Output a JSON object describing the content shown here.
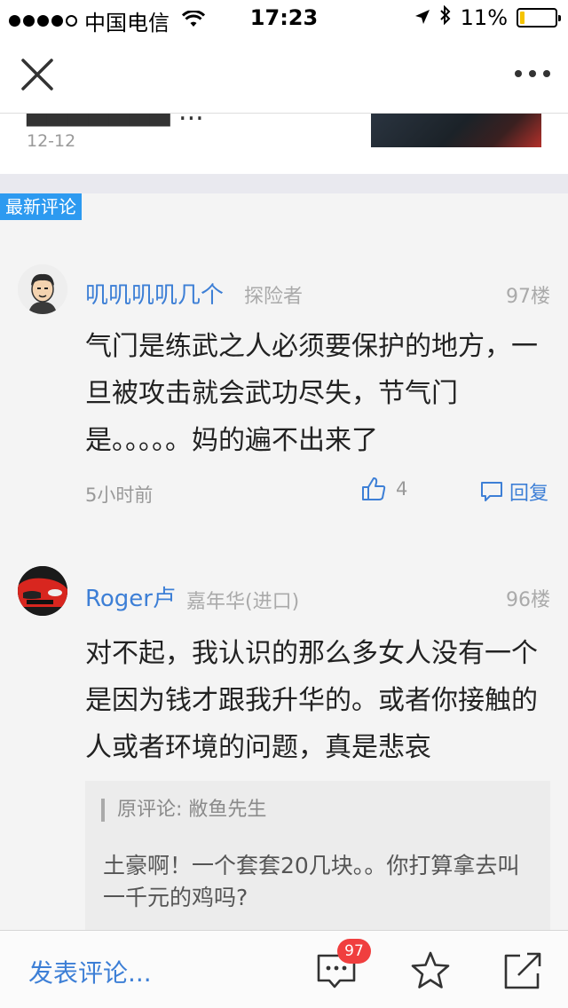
{
  "status_bar": {
    "carrier": "中国电信",
    "time": "17:23",
    "battery": "11%",
    "battery_level": 0.11
  },
  "nav": {
    "close_icon": "close-icon",
    "more_icon": "more-icon"
  },
  "article_peek": {
    "date": "12-12"
  },
  "section": {
    "label": "最新评论",
    "accent": "#2d9af0"
  },
  "comments": [
    {
      "user": "叽叽叽叽几个",
      "tag": "探险者",
      "floor": "97楼",
      "text": "气门是练武之人必须要保护的地方，一旦被攻击就会武功尽失，节气门是。。。。。妈的遍不出来了",
      "time": "5小时前",
      "likes": "4",
      "reply_label": "回复"
    },
    {
      "user": "Roger卢",
      "tag": "嘉年华(进口)",
      "floor": "96楼",
      "text": "对不起，我认识的那么多女人没有一个是因为钱才跟我升华的。或者你接触的人或者环境的问题，真是悲哀",
      "quote": {
        "label": "原评论: 敝鱼先生",
        "text": "土豪啊！一个套套20几块。。你打算拿去叫一千元的鸡吗?"
      }
    }
  ],
  "bottom_bar": {
    "write_label": "发表评论...",
    "comment_count": "97",
    "link_color": "#3d7fd6",
    "badge_color": "#f03f3f"
  }
}
